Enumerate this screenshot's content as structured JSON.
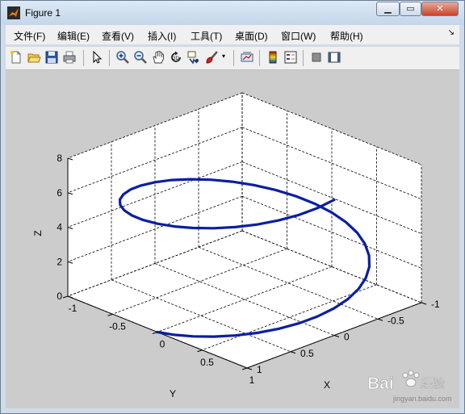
{
  "window": {
    "title": "Figure 1",
    "minimize_glyph": "▁",
    "maximize_glyph": "▭",
    "close_glyph": "✕"
  },
  "menu": {
    "items": [
      "文件(F)",
      "编辑(E)",
      "查看(V)",
      "插入(I)",
      "工具(T)",
      "桌面(D)",
      "窗口(W)",
      "帮助(H)"
    ],
    "overflow_glyph": "↘"
  },
  "toolbar": {
    "icons": [
      "new-figure-icon",
      "open-file-icon",
      "save-icon",
      "print-icon",
      "pointer-icon",
      "zoom-in-icon",
      "zoom-out-icon",
      "pan-icon",
      "rotate-3d-icon",
      "data-cursor-icon",
      "brush-icon",
      "link-plot-icon",
      "colorbar-icon",
      "legend-icon",
      "hide-plot-tools-icon",
      "show-plot-tools-icon"
    ]
  },
  "watermark": {
    "brand": "Bai",
    "brand_suffix": "经验",
    "url": "jingyan.baidu.com"
  },
  "chart_data": {
    "type": "line3d",
    "title": "",
    "xlabel": "X",
    "ylabel": "Y",
    "zlabel": "Z",
    "xlim": [
      -1,
      1
    ],
    "ylim": [
      -1,
      1
    ],
    "zlim": [
      0,
      8
    ],
    "x_ticks": [
      "-1",
      "-0.5",
      "0",
      "0.5",
      "1"
    ],
    "y_ticks": [
      "-1",
      "-0.5",
      "0",
      "0.5",
      "1"
    ],
    "z_ticks": [
      "0",
      "2",
      "4",
      "6",
      "8"
    ],
    "grid": true,
    "view": "default 3-D (az -37.5, el 30)",
    "series": [
      {
        "color": "#0b1fa0",
        "x": [
          0.0,
          0.174,
          0.342,
          0.5,
          0.643,
          0.766,
          0.866,
          0.94,
          0.985,
          1.0,
          0.985,
          0.94,
          0.866,
          0.766,
          0.643,
          0.5,
          0.342,
          0.174,
          0.0,
          -0.174,
          -0.342,
          -0.5,
          -0.643,
          -0.766,
          -0.866,
          -0.94,
          -0.985,
          -1.0,
          -0.985,
          -0.94,
          -0.866,
          -0.766,
          -0.643,
          -0.5,
          -0.342,
          -0.174,
          0.0,
          0.174,
          0.342,
          0.5,
          0.643,
          0.766,
          0.866,
          0.94,
          0.985,
          1.0
        ],
        "y": [
          1.0,
          0.985,
          0.94,
          0.866,
          0.766,
          0.643,
          0.5,
          0.342,
          0.174,
          0.0,
          -0.174,
          -0.342,
          -0.5,
          -0.643,
          -0.766,
          -0.866,
          -0.94,
          -0.985,
          -1.0,
          -0.985,
          -0.94,
          -0.866,
          -0.766,
          -0.643,
          -0.5,
          -0.342,
          -0.174,
          0.0,
          0.174,
          0.342,
          0.5,
          0.643,
          0.766,
          0.866,
          0.94,
          0.985,
          1.0,
          0.985,
          0.94,
          0.866,
          0.766,
          0.643,
          0.5,
          0.342,
          0.174,
          0.0
        ],
        "z": [
          0.0,
          0.175,
          0.349,
          0.524,
          0.698,
          0.873,
          1.047,
          1.222,
          1.396,
          1.571,
          1.745,
          1.92,
          2.094,
          2.269,
          2.443,
          2.618,
          2.793,
          2.967,
          3.142,
          3.316,
          3.491,
          3.665,
          3.84,
          4.014,
          4.189,
          4.363,
          4.538,
          4.712,
          4.887,
          5.061,
          5.236,
          5.411,
          5.585,
          5.76,
          5.934,
          6.109,
          6.283,
          6.458,
          6.632,
          6.807,
          6.981,
          7.156,
          7.33,
          7.505,
          7.679,
          7.854
        ]
      }
    ]
  }
}
